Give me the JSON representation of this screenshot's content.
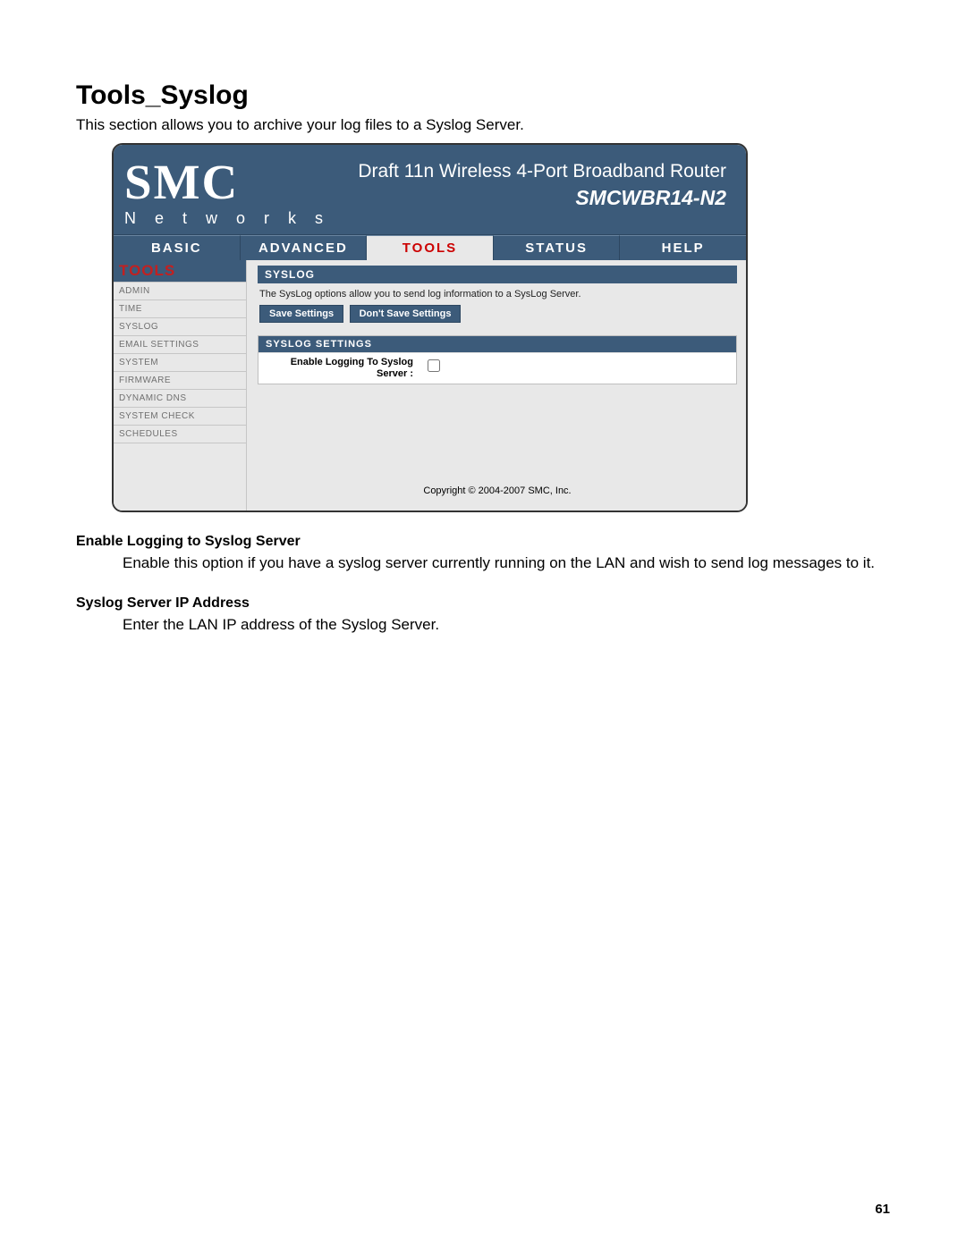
{
  "doc": {
    "title": "Tools_Syslog",
    "intro": "This section allows you to archive your log files to a Syslog Server.",
    "section1_title": "Enable Logging to Syslog Server",
    "section1_body": "Enable this option if you have a syslog server currently running on the LAN and wish to send log messages to it.",
    "section2_title": "Syslog Server IP Address",
    "section2_body": "Enter the LAN IP address of the Syslog Server.",
    "page_number": "61"
  },
  "router": {
    "logo_big": "SMC",
    "logo_sub": "N e t w o r k s",
    "header_line1": "Draft 11n Wireless 4-Port Broadband Router",
    "header_line2": "SMCWBR14-N2",
    "tabs": [
      "BASIC",
      "ADVANCED",
      "TOOLS",
      "STATUS",
      "HELP"
    ],
    "active_tab_index": 2,
    "sidebar_title": "TOOLS",
    "sidebar": [
      "ADMIN",
      "TIME",
      "SYSLOG",
      "EMAIL SETTINGS",
      "SYSTEM",
      "FIRMWARE",
      "DYNAMIC DNS",
      "SYSTEM CHECK",
      "SCHEDULES"
    ],
    "panel_header": "SYSLOG",
    "panel_desc": "The SysLog options allow you to send log information to a SysLog Server.",
    "btn_save": "Save Settings",
    "btn_dontsave": "Don't Save Settings",
    "settings_header": "SYSLOG SETTINGS",
    "settings_row_label": "Enable Logging To Syslog Server :",
    "copyright": "Copyright © 2004-2007 SMC, Inc."
  }
}
